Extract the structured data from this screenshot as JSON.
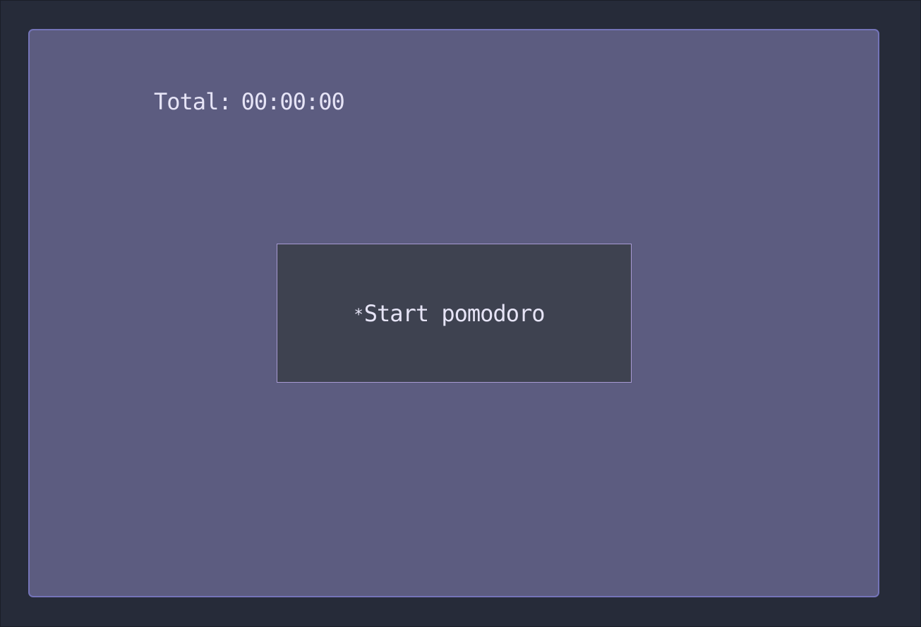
{
  "timer": {
    "total_label": "Total:",
    "total_value": "00:00:00"
  },
  "start_button": {
    "icon_glyph": "*",
    "label": "Start pomodoro"
  },
  "colors": {
    "background": "#262b39",
    "panel": "#5c5c80",
    "panel_border": "#7474b8",
    "button": "#3e4250",
    "button_border": "#a79ad2",
    "text": "#e6e4f6"
  }
}
